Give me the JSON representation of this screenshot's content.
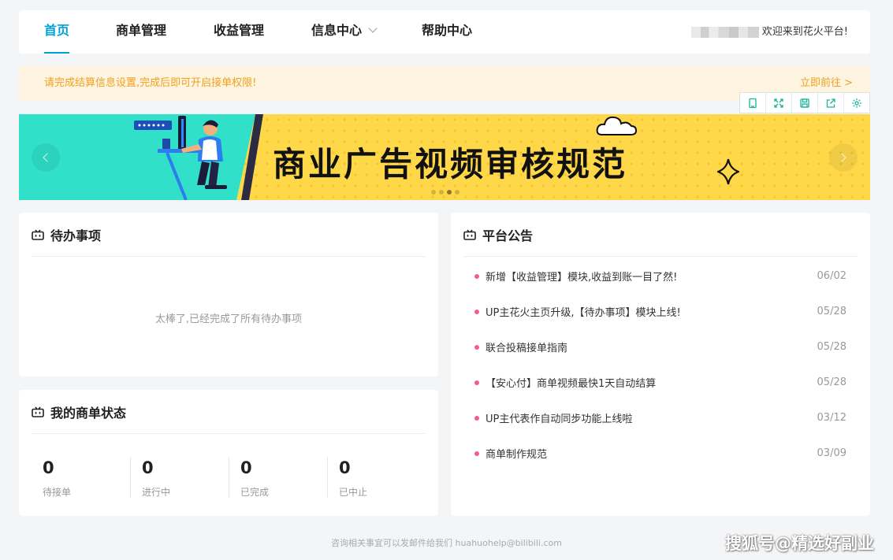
{
  "nav": {
    "items": [
      {
        "label": "首页",
        "active": true
      },
      {
        "label": "商单管理"
      },
      {
        "label": "收益管理"
      },
      {
        "label": "信息中心",
        "dropdown": true
      },
      {
        "label": "帮助中心"
      }
    ],
    "welcome": "欢迎来到花火平台!"
  },
  "alert": {
    "message": "请完成结算信息设置,完成后即可开启接单权限!",
    "link": "立即前往 >"
  },
  "toolbar": {
    "icons": [
      "copy-icon",
      "expand-icon",
      "save-icon",
      "share-icon",
      "settings-icon"
    ]
  },
  "banner": {
    "title": "商业广告视频审核规范",
    "slide_count": 4,
    "active_slide": 3
  },
  "todo": {
    "title": "待办事项",
    "empty_message": "太棒了,已经完成了所有待办事项"
  },
  "orders": {
    "title": "我的商单状态",
    "stats": [
      {
        "value": "0",
        "label": "待接单"
      },
      {
        "value": "0",
        "label": "进行中"
      },
      {
        "value": "0",
        "label": "已完成"
      },
      {
        "value": "0",
        "label": "已中止"
      }
    ]
  },
  "notices": {
    "title": "平台公告",
    "items": [
      {
        "text": "新增【收益管理】模块,收益到账一目了然!",
        "date": "06/02"
      },
      {
        "text": "UP主花火主页升级,【待办事项】模块上线!",
        "date": "05/28"
      },
      {
        "text": "联合投稿接单指南",
        "date": "05/28"
      },
      {
        "text": "【安心付】商单视频最快1天自动结算",
        "date": "05/28"
      },
      {
        "text": "UP主代表作自动同步功能上线啦",
        "date": "03/12"
      },
      {
        "text": "商单制作规范",
        "date": "03/09"
      }
    ]
  },
  "footer": {
    "text": "咨询相关事宜可以发邮件给我们 huahuohelp@bilibili.com"
  },
  "watermark": "搜狐号@精选好副业",
  "colors": {
    "accent": "#00a1d6",
    "alert_bg": "#fff4df",
    "alert_text": "#f0a020",
    "notice_dot": "#f25d8e",
    "banner_yellow": "#ffd84a",
    "banner_teal": "#30e0c8"
  }
}
